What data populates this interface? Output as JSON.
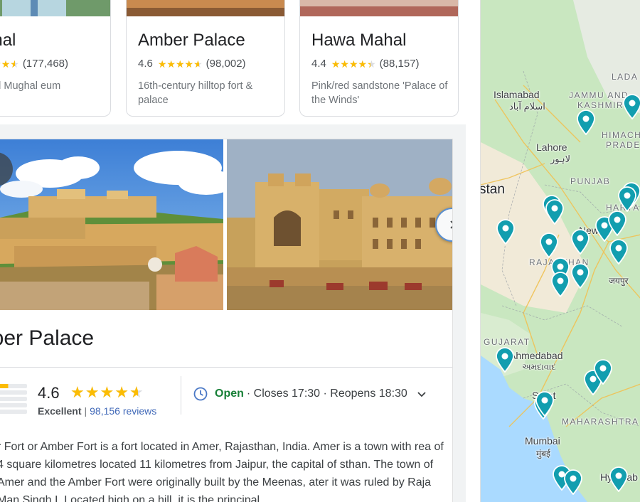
{
  "cards": [
    {
      "title": "Mahal",
      "rating": "",
      "stars": 4.5,
      "reviews": "(177,468)",
      "desc": "domed Mughal eum"
    },
    {
      "title": "Amber Palace",
      "rating": "4.6",
      "stars": 4.6,
      "reviews": "(98,002)",
      "desc": "16th-century hilltop fort & palace"
    },
    {
      "title": "Hawa Mahal",
      "rating": "4.4",
      "stars": 4.4,
      "reviews": "(88,157)",
      "desc": "Pink/red sandstone 'Palace of the Winds'"
    }
  ],
  "panel": {
    "title": "nber Palace",
    "rating": "4.6",
    "stars": 4.6,
    "rating_label": "Excellent",
    "separator": "|",
    "reviews": "98,156 reviews",
    "hours_open": "Open",
    "hours_rest": "· Closes 17:30 · Reopens 18:30",
    "description": "r Fort or Amber Fort is a fort located in Amer, Rajasthan, India. Amer is a town with rea of 4 square kilometres located 11 kilometres from Jaipur, the capital of sthan. The town of Amer and the Amber Fort were originally built by the Meenas, ater it was ruled by Raja Man Singh I. Located high on a hill, it is the principal",
    "icons": {
      "clock": "clock-icon",
      "expand": "chevron-down-icon",
      "next": "chevron-right-icon",
      "prev": "chevron-left-icon"
    }
  },
  "map": {
    "labels": {
      "islamabad": "Islamabad",
      "islamabad_urdu": "اسلام آباد",
      "lahore": "Lahore",
      "lahore_urdu": "لاہور",
      "jammu": "JAMMU AND",
      "kashmir": "KASHMIR",
      "ladakh": "LADA",
      "himachal": "HIMACH",
      "pradesh": "PRADE",
      "stan": "stan",
      "punjab": "PUNJAB",
      "haryana": "HARYA",
      "new_delhi": "New D",
      "rajasthan": "RAJASTHAN",
      "jaipur_hindi": "जयपुर",
      "gujarat": "GUJARAT",
      "ahmedabad": "Ahmedabad",
      "ahmedabad_guj": "અમદાવાદ",
      "surat": "Surat",
      "maharashtra": "MAHARASHTRA",
      "mumbai": "Mumbai",
      "mumbai_hindi": "मुंबई",
      "hyderabad": "Hyderab"
    },
    "colors": {
      "water": "#aadaff",
      "land": "#c9e7c0",
      "desert": "#f1ead8",
      "pin": "#129eaf"
    }
  }
}
